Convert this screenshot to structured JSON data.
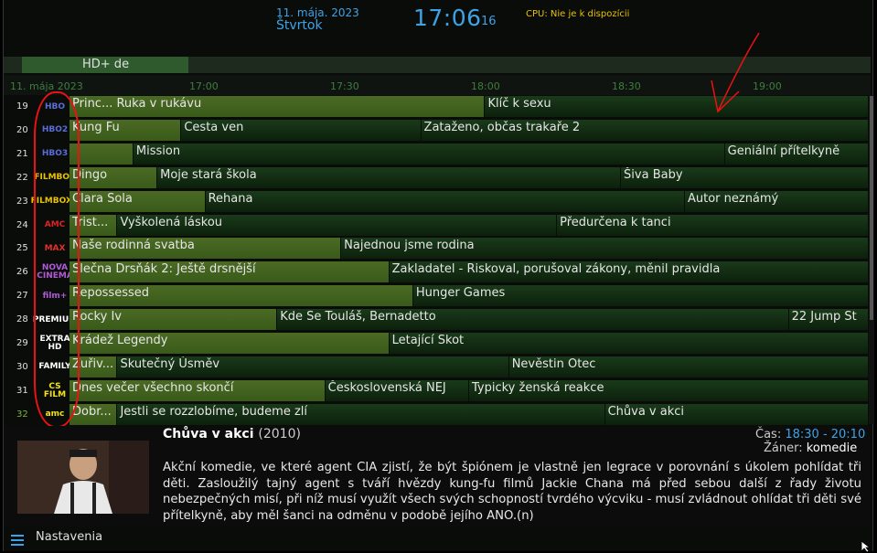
{
  "header": {
    "date": "11. mája. 2023",
    "day": "Štvrtok",
    "clock": "17:06",
    "clock_seconds": "16",
    "cpu": "CPU: Nie je k dispozícii"
  },
  "channel_group": "HD+ de",
  "timeline": {
    "date": "11. mája 2023",
    "ticks": [
      "17:00",
      "17:30",
      "18:00",
      "18:30",
      "19:00"
    ]
  },
  "channels": [
    {
      "num": "19",
      "logo": "HBO",
      "logo_color": "#5a6dd8",
      "programs": [
        {
          "title": "Princ... Ruka v rukávu",
          "start": 0,
          "end": 0.52,
          "past": true
        },
        {
          "title": "Klíč k sexu",
          "start": 0.52,
          "end": 1
        }
      ]
    },
    {
      "num": "20",
      "logo": "HBO2",
      "logo_color": "#5a6dd8",
      "programs": [
        {
          "title": "Kung Fu",
          "start": 0,
          "end": 0.14,
          "past": true
        },
        {
          "title": "Cesta ven",
          "start": 0.14,
          "end": 0.44
        },
        {
          "title": "Zataženo, občas trakaře 2",
          "start": 0.44,
          "end": 1
        }
      ]
    },
    {
      "num": "21",
      "logo": "HBO3",
      "logo_color": "#5a6dd8",
      "programs": [
        {
          "title": "",
          "start": 0,
          "end": 0.08,
          "past": true
        },
        {
          "title": "Mission",
          "start": 0.08,
          "end": 0.82
        },
        {
          "title": "Geniální přítelkyně",
          "start": 0.82,
          "end": 1
        }
      ]
    },
    {
      "num": "22",
      "logo": "FILMBOX",
      "logo_color": "#e9c200",
      "programs": [
        {
          "title": "Dingo",
          "start": 0,
          "end": 0.11,
          "past": true
        },
        {
          "title": "Moje stará škola",
          "start": 0.11,
          "end": 0.69
        },
        {
          "title": "Šiva Baby",
          "start": 0.69,
          "end": 1
        }
      ]
    },
    {
      "num": "23",
      "logo": "FILMBOX+",
      "logo_color": "#e9c200",
      "programs": [
        {
          "title": "Clara Sola",
          "start": 0,
          "end": 0.17,
          "past": true
        },
        {
          "title": "Rehana",
          "start": 0.17,
          "end": 0.77
        },
        {
          "title": "Autor neznámý",
          "start": 0.77,
          "end": 1
        }
      ]
    },
    {
      "num": "24",
      "logo": "AMC",
      "logo_color": "#d22",
      "programs": [
        {
          "title": "Trist...",
          "start": 0,
          "end": 0.06,
          "past": true
        },
        {
          "title": "Vyškolená láskou",
          "start": 0.06,
          "end": 0.61
        },
        {
          "title": "Předurčena k tanci",
          "start": 0.61,
          "end": 1
        }
      ]
    },
    {
      "num": "25",
      "logo": "MAX",
      "logo_color": "#e0302a",
      "programs": [
        {
          "title": "Naše rodinná svatba",
          "start": 0,
          "end": 0.34,
          "past": true
        },
        {
          "title": "Najednou jsme rodina",
          "start": 0.34,
          "end": 1
        }
      ]
    },
    {
      "num": "26",
      "logo": "NOVA CINEMA",
      "logo_color": "#b05ad8",
      "programs": [
        {
          "title": "Slečna Drsňák 2: Ještě drsnější",
          "start": 0,
          "end": 0.4,
          "past": true
        },
        {
          "title": "Zakladatel - Riskoval, porušoval zákony, měnil pravidla",
          "start": 0.4,
          "end": 1
        }
      ]
    },
    {
      "num": "27",
      "logo": "film+",
      "logo_color": "#b05ad8",
      "programs": [
        {
          "title": "Repossessed",
          "start": 0,
          "end": 0.43,
          "past": true
        },
        {
          "title": "Hunger Games",
          "start": 0.43,
          "end": 1
        }
      ]
    },
    {
      "num": "28",
      "logo": "PREMIUM",
      "logo_color": "#fff",
      "programs": [
        {
          "title": "Rocky Iv",
          "start": 0,
          "end": 0.26,
          "past": true
        },
        {
          "title": "Kde Se Touláš, Bernadetto",
          "start": 0.26,
          "end": 0.9
        },
        {
          "title": "22 Jump St",
          "start": 0.9,
          "end": 1
        }
      ]
    },
    {
      "num": "29",
      "logo": "EXTRA HD",
      "logo_color": "#fff",
      "programs": [
        {
          "title": "Krádež Legendy",
          "start": 0,
          "end": 0.4,
          "past": true
        },
        {
          "title": "Letající Skot",
          "start": 0.4,
          "end": 1
        }
      ]
    },
    {
      "num": "30",
      "logo": "FAMILY",
      "logo_color": "#fff",
      "programs": [
        {
          "title": "Zuřiv...",
          "start": 0,
          "end": 0.06,
          "past": true
        },
        {
          "title": "Skutečný Úsměv",
          "start": 0.06,
          "end": 0.55
        },
        {
          "title": "Nevěstin Otec",
          "start": 0.55,
          "end": 1
        }
      ]
    },
    {
      "num": "31",
      "logo": "CS FILM",
      "logo_color": "#f4e21a",
      "programs": [
        {
          "title": "Dnes večer všechno skončí",
          "start": 0,
          "end": 0.32,
          "past": true
        },
        {
          "title": "Československá NEJ",
          "start": 0.32,
          "end": 0.5
        },
        {
          "title": "Typicky ženská reakce",
          "start": 0.5,
          "end": 1
        }
      ]
    },
    {
      "num": "32",
      "logo": "amc",
      "logo_color": "#f4e21a",
      "programs": [
        {
          "title": "Dobr...",
          "start": 0,
          "end": 0.06,
          "past": true
        },
        {
          "title": "Jestli se rozzlobíme, budeme zlí",
          "start": 0.06,
          "end": 0.67
        },
        {
          "title": "Chůva v akci",
          "start": 0.67,
          "end": 1
        }
      ]
    }
  ],
  "details": {
    "title": "Chůva v akci",
    "year": "(2010)",
    "time_label": "Čas:",
    "time_value": "18:30 - 20:10",
    "genre_label": "Žáner:",
    "genre_value": "komedie",
    "description": "Akční komedie, ve které agent CIA zjistí, že být špiónem je vlastně jen legrace v porovnání s úkolem pohlídat tři děti. Zasloužilý tajný agent s tváří hvězdy kung-fu filmů Jackie Chana má před sebou další z řady životu nebezpečných misí, při níž musí využít všech svých schopností tvrdého výcviku - musí zvládnout ohlídat tři děti své přítelkyně, aby měl šanci na odměnu v podobě jejího ANO.(n)"
  },
  "footer": {
    "menu_label": "Nastavenia",
    "menu_icon": "hamburger-icon"
  },
  "colors": {
    "accent": "#3ea3e6",
    "cpu": "#e9c200",
    "annotation": "#e11111"
  }
}
